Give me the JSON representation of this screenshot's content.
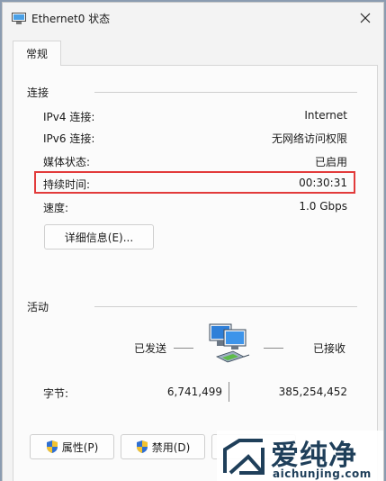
{
  "window": {
    "title": "Ethernet0 状态"
  },
  "tab": {
    "label": "常规"
  },
  "connection": {
    "heading": "连接",
    "ipv4": {
      "label": "IPv4 连接:",
      "value": "Internet"
    },
    "ipv6": {
      "label": "IPv6 连接:",
      "value": "无网络访问权限"
    },
    "media": {
      "label": "媒体状态:",
      "value": "已启用"
    },
    "duration": {
      "label": "持续时间:",
      "value": "00:30:31"
    },
    "speed": {
      "label": "速度:",
      "value": "1.0 Gbps"
    },
    "details_button": "详细信息(E)..."
  },
  "activity": {
    "heading": "活动",
    "sent_label": "已发送",
    "received_label": "已接收",
    "bytes_label": "字节:",
    "bytes_sent": "6,741,499",
    "bytes_received": "385,254,452"
  },
  "buttons": {
    "properties": "属性(P)",
    "disable": "禁用(D)"
  },
  "watermark": {
    "brand": "爱纯净",
    "url": "aichunjing.com"
  },
  "colors": {
    "highlight": "#e23b3b",
    "brand": "#1f3f5a",
    "shield_blue": "#2f6fd1",
    "shield_yellow": "#f2c230"
  }
}
